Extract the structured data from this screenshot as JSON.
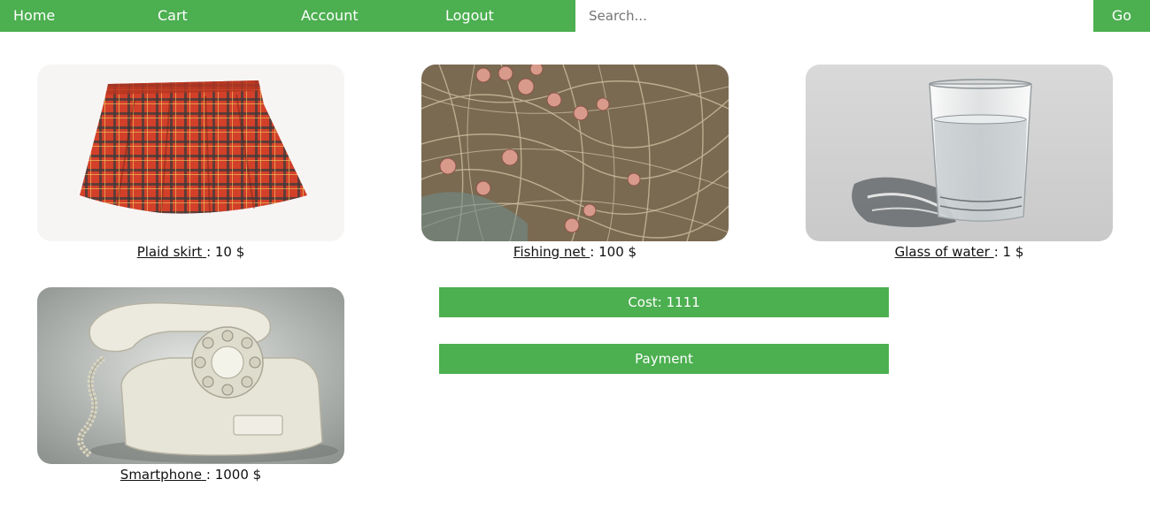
{
  "nav": {
    "links": [
      "Home",
      "Cart",
      "Account",
      "Logout"
    ],
    "search_placeholder": "Search...",
    "go_label": "Go"
  },
  "products": [
    {
      "name": "Plaid skirt ",
      "price": ": 10 $"
    },
    {
      "name": "Fishing net ",
      "price": ": 100 $"
    },
    {
      "name": "Glass of water ",
      "price": ": 1 $"
    },
    {
      "name": "Smartphone ",
      "price": ": 1000 $"
    }
  ],
  "cart": {
    "cost_label": "Cost: 1111",
    "payment_label": "Payment"
  },
  "colors": {
    "accent": "#4caf50",
    "text": "#111111"
  }
}
